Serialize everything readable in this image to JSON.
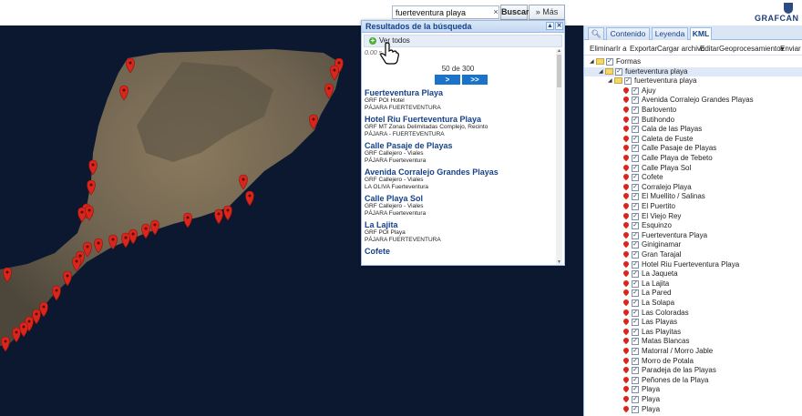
{
  "search": {
    "value": "fuerteventura playa",
    "clear": "×",
    "buscar_label": "Buscar",
    "mas_label": "Más",
    "mas_icon": "double-chevron-down-icon"
  },
  "logo": {
    "text": "GRAFCAN"
  },
  "results": {
    "title": "Resultados de la búsqueda",
    "ver_todos": "Ver todos",
    "elapsed": "0.00 s",
    "count": "50 de 300",
    "next_label": ">",
    "last_label": ">>",
    "items": [
      {
        "title": "Fuerteventura Playa",
        "lines": [
          "GRF POI Hotel",
          "PÁJARA FUERTEVENTURA"
        ]
      },
      {
        "title": "Hotel Riu Fuerteventura Playa",
        "lines": [
          "GRF MT Zonas Delimitadas Complejo, Recinto",
          "PÁJARA - FUERTEVENTURA"
        ]
      },
      {
        "title": "Calle Pasaje de Playas",
        "lines": [
          "GRF Callejero - Viales",
          "PÁJARA Fuerteventura"
        ]
      },
      {
        "title": "Avenida Corralejo Grandes Playas",
        "lines": [
          "GRF Callejero - Viales",
          "LA OLIVA Fuerteventura"
        ]
      },
      {
        "title": "Calle Playa Sol",
        "lines": [
          "GRF Callejero - Viales",
          "PÁJARA Fuerteventura"
        ]
      },
      {
        "title": "La Lajita",
        "lines": [
          "GRF POI Playa",
          "PÁJARA FUERTEVENTURA"
        ]
      },
      {
        "title": "Cofete",
        "lines": []
      }
    ]
  },
  "panel": {
    "tabs": [
      {
        "label": "",
        "icon": "search-icon"
      },
      {
        "label": "Contenido"
      },
      {
        "label": "Leyenda"
      },
      {
        "label": "KML"
      }
    ],
    "toolbar": [
      "Eliminar",
      "Ir a",
      "Exportar",
      "Cargar archivo",
      "Editar",
      "Geoprocesamiento▾",
      "Enviar"
    ],
    "tree_root": "Formas",
    "tree_l1": "fuerteventura playa",
    "tree_l2": "fuerteventura playa",
    "places": [
      "Ajuy",
      "Avenida Corralejo Grandes Playas",
      "Barlovento",
      "Butihondo",
      "Cala de las Playas",
      "Caleta de Fuste",
      "Calle Pasaje de Playas",
      "Calle Playa de Tebeto",
      "Calle Playa Sol",
      "Cofete",
      "Corralejo Playa",
      "El Muellito / Salinas",
      "El Puertito",
      "El Viejo Rey",
      "Esquinzo",
      "Fuerteventura Playa",
      "Giniginamar",
      "Gran Tarajal",
      "Hotel Riu Fuerteventura Playa",
      "La Jaqueta",
      "La Lajita",
      "La Pared",
      "La Solapa",
      "Las Coloradas",
      "Las Playas",
      "Las Playitas",
      "Matas Blancas",
      "Matorral / Morro Jable",
      "Morro de Potala",
      "Paradeja de las Playas",
      "Peñones de la Playa",
      "Playa",
      "Playa",
      "Playa"
    ]
  },
  "colors": {
    "accent": "#15428b",
    "marker": "#d9261c",
    "sea": "#0c1830",
    "pager": "#1a73c9"
  }
}
